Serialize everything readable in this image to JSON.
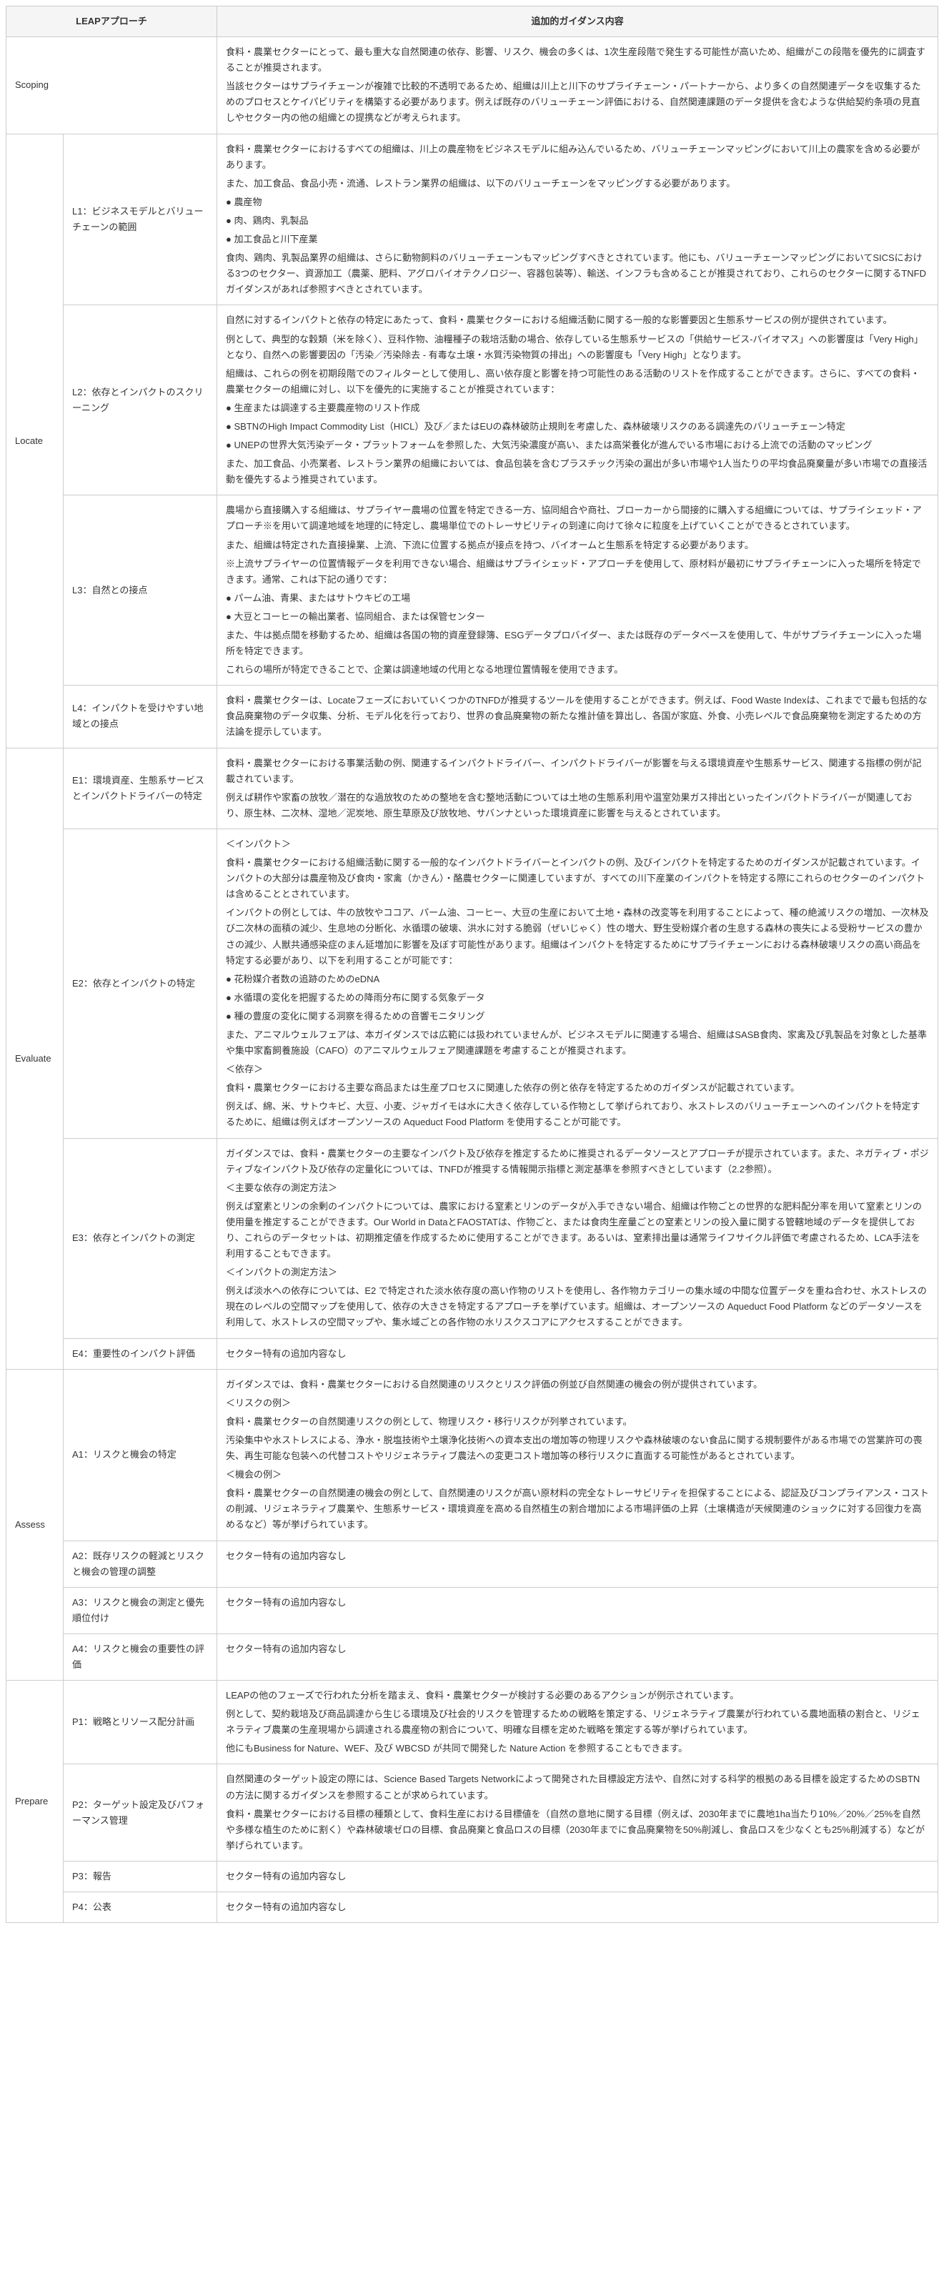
{
  "headers": {
    "approach": "LEAPアプローチ",
    "content": "追加的ガイダンス内容"
  },
  "phases": {
    "scoping": "Scoping",
    "locate": "Locate",
    "evaluate": "Evaluate",
    "assess": "Assess",
    "prepare": "Prepare"
  },
  "sub": {
    "l1": "L1：ビジネスモデルとバリューチェーンの範囲",
    "l2": "L2：依存とインパクトのスクリーニング",
    "l3": "L3：自然との接点",
    "l4": "L4：インパクトを受けやすい地域との接点",
    "e1": "E1：環境資産、生態系サービスとインパクトドライバーの特定",
    "e2": "E2：依存とインパクトの特定",
    "e3": "E3：依存とインパクトの測定",
    "e4": "E4：重要性のインパクト評価",
    "a1": "A1：リスクと機会の特定",
    "a2": "A2：既存リスクの軽減とリスクと機会の管理の調整",
    "a3": "A3：リスクと機会の測定と優先順位付け",
    "a4": "A4：リスクと機会の重要性の評価",
    "p1": "P1：戦略とリソース配分計画",
    "p2": "P2：ターゲット設定及びパフォーマンス管理",
    "p3": "P3：報告",
    "p4": "P4：公表"
  },
  "content": {
    "scoping": [
      "食料・農業セクターにとって、最も重大な自然関連の依存、影響、リスク、機会の多くは、1次生産段階で発生する可能性が高いため、組織がこの段階を優先的に調査することが推奨されます。",
      "当該セクターはサプライチェーンが複雑で比較的不透明であるため、組織は川上と川下のサプライチェーン・パートナーから、より多くの自然関連データを収集するためのプロセスとケイパビリティを構築する必要があります。例えば既存のバリューチェーン評価における、自然関連課題のデータ提供を含むような供給契約条項の見直しやセクター内の他の組織との提携などが考えられます。"
    ],
    "l1": [
      "食料・農業セクターにおけるすべての組織は、川上の農産物をビジネスモデルに組み込んでいるため、バリューチェーンマッピングにおいて川上の農家を含める必要があります。",
      "また、加工食品、食品小売・流通、レストラン業界の組織は、以下のバリューチェーンをマッピングする必要があります。",
      "● 農産物",
      "● 肉、鶏肉、乳製品",
      "● 加工食品と川下産業",
      "食肉、鶏肉、乳製品業界の組織は、さらに動物飼料のバリューチェーンもマッピングすべきとされています。他にも、バリューチェーンマッピングにおいてSICSにおける3つのセクター、資源加工（農薬、肥料、アグロバイオテクノロジー、容器包装等）、輸送、インフラも含めることが推奨されており、これらのセクターに関するTNFDガイダンスがあれば参照すべきとされています。"
    ],
    "l2": [
      "自然に対するインパクトと依存の特定にあたって、食料・農業セクターにおける組織活動に関する一般的な影響要因と生態系サービスの例が提供されています。",
      "例として、典型的な穀類（米を除く）、豆科作物、油糧種子の栽培活動の場合、依存している生態系サービスの「供給サービス-バイオマス」への影響度は「Very High」となり、自然への影響要因の「汚染／汚染除去 - 有毒な土壌・水質汚染物質の排出」への影響度も「Very High」となります。",
      "組織は、これらの例を初期段階でのフィルターとして使用し、高い依存度と影響を持つ可能性のある活動のリストを作成することができます。さらに、すべての食料・農業セクターの組織に対し、以下を優先的に実施することが推奨されています：",
      "● 生産または調達する主要農産物のリスト作成",
      "● SBTNのHigh Impact Commodity List（HICL）及び／またはEUの森林破防止規則を考慮した、森林破壊リスクのある調達先のバリューチェーン特定",
      "● UNEPの世界大気汚染データ・プラットフォームを参照した、大気汚染濃度が高い、または高栄養化が進んでいる市場における上流での活動のマッピング",
      "また、加工食品、小売業者、レストラン業界の組織においては、食品包装を含むプラスチック汚染の漏出が多い市場や1人当たりの平均食品廃棄量が多い市場での直接活動を優先するよう推奨されています。"
    ],
    "l3": [
      "農場から直接購入する組織は、サプライヤー農場の位置を特定できる一方、協同組合や商社、ブローカーから間接的に購入する組織については、サプライシェッド・アプローチ※を用いて調達地域を地理的に特定し、農場単位でのトレーサビリティの到達に向けて徐々に粒度を上げていくことができるとされています。",
      "また、組織は特定された直接操業、上流、下流に位置する拠点が接点を持つ、バイオームと生態系を特定する必要があります。",
      "※上流サプライヤーの位置情報データを利用できない場合、組織はサプライシェッド・アプローチを使用して、原材料が最初にサプライチェーンに入った場所を特定できます。通常、これは下記の通りです：",
      "● パーム油、青果、またはサトウキビの工場",
      "● 大豆とコーヒーの輸出業者、協同組合、または保管センター",
      "また、牛は拠点間を移動するため、組織は各国の物的資産登録簿、ESGデータプロバイダー、または既存のデータベースを使用して、牛がサプライチェーンに入った場所を特定できます。",
      "これらの場所が特定できることで、企業は調達地域の代用となる地理位置情報を使用できます。"
    ],
    "l4": [
      "食料・農業セクターは、LocateフェーズにおいていくつかのTNFDが推奨するツールを使用することができます。例えば、Food Waste Indexは、これまでで最も包括的な食品廃棄物のデータ収集、分析、モデル化を行っており、世界の食品廃棄物の新たな推計値を算出し、各国が家庭、外食、小売レベルで食品廃棄物を測定するための方法論を提示しています。"
    ],
    "e1": [
      "食料・農業セクターにおける事業活動の例、関連するインパクトドライバー、インパクトドライバーが影響を与える環境資産や生態系サービス、関連する指標の例が記載されています。",
      "例えば耕作や家畜の放牧／潜在的な過放牧のための整地を含む整地活動については土地の生態系利用や温室効果ガス排出といったインパクトドライバーが関連しており、原生林、二次林、湿地／泥炭地、原生草原及び放牧地、サバンナといった環境資産に影響を与えるとされています。"
    ],
    "e2": [
      "＜インパクト＞",
      "食料・農業セクターにおける組織活動に関する一般的なインパクトドライバーとインパクトの例、及びインパクトを特定するためのガイダンスが記載されています。インパクトの大部分は農産物及び食肉・家禽（かきん）・酪農セクターに関連していますが、すべての川下産業のインパクトを特定する際にこれらのセクターのインパクトは含めることとされています。",
      "インパクトの例としては、牛の放牧やココア、パーム油、コーヒー、大豆の生産において土地・森林の改変等を利用することによって、種の絶滅リスクの増加、一次林及び二次林の面積の減少、生息地の分断化、水循環の破壊、洪水に対する脆弱（ぜいじゃく）性の増大、野生受粉媒介者の生息する森林の喪失による受粉サービスの豊かさの減少、人獣共通感染症のまん延増加に影響を及ぼす可能性があります。組織はインパクトを特定するためにサプライチェーンにおける森林破壊リスクの高い商品を特定する必要があり、以下を利用することが可能です：",
      "● 花粉媒介者数の追跡のためのeDNA",
      "● 水循環の変化を把握するための降雨分布に関する気象データ",
      "● 種の豊度の変化に関する洞察を得るための音響モニタリング",
      "また、アニマルウェルフェアは、本ガイダンスでは広範には扱われていませんが、ビジネスモデルに関連する場合、組織はSASB食肉、家禽及び乳製品を対象とした基準や集中家畜飼養施設（CAFO）のアニマルウェルフェア関連課題を考慮することが推奨されます。",
      "＜依存＞",
      "食料・農業セクターにおける主要な商品または生産プロセスに関連した依存の例と依存を特定するためのガイダンスが記載されています。",
      "例えば、綿、米、サトウキビ、大豆、小麦、ジャガイモは水に大きく依存している作物として挙げられており、水ストレスのバリューチェーンへのインパクトを特定するために、組織は例えばオープンソースの Aqueduct Food Platform を使用することが可能です。"
    ],
    "e3": [
      "ガイダンスでは、食料・農業セクターの主要なインパクト及び依存を推定するために推奨されるデータソースとアプローチが提示されています。また、ネガティブ・ポジティブなインパクト及び依存の定量化については、TNFDが推奨する情報開示指標と測定基準を参照すべきとしています（2.2参照）。",
      "＜主要な依存の測定方法＞",
      "例えば窒素とリンの余剰のインパクトについては、農家における窒素とリンのデータが入手できない場合、組織は作物ごとの世界的な肥料配分率を用いて窒素とリンの使用量を推定することができます。Our World in DataとFAOSTATは、作物ごと、または食肉生産量ごとの窒素とリンの投入量に関する管轄地域のデータを提供しており、これらのデータセットは、初期推定値を作成するために使用することができます。あるいは、窒素排出量は通常ライフサイクル評価で考慮されるため、LCA手法を利用することもできます。",
      "＜インパクトの測定方法＞",
      "例えば淡水への依存については、E2 で特定された淡水依存度の高い作物のリストを使用し、各作物カテゴリーの集水域の中間な位置データを重ね合わせ、水ストレスの現在のレベルの空間マップを使用して、依存の大きさを特定するアプローチを挙げています。組織は、オープンソースの Aqueduct Food Platform などのデータソースを利用して、水ストレスの空間マップや、集水域ごとの各作物の水リスクスコアにアクセスすることができます。"
    ],
    "e4": [
      "セクター特有の追加内容なし"
    ],
    "a1": [
      "ガイダンスでは、食料・農業セクターにおける自然関連のリスクとリスク評価の例並び自然関連の機会の例が提供されています。",
      "＜リスクの例＞",
      "食料・農業セクターの自然関連リスクの例として、物理リスク・移行リスクが列挙されています。",
      "汚染集中や水ストレスによる、浄水・脱塩技術や土壌浄化技術への資本支出の増加等の物理リスクや森林破壊のない食品に関する規制要件がある市場での営業許可の喪失、再生可能な包装への代替コストやリジェネラティブ農法への変更コスト増加等の移行リスクに直面する可能性があるとされています。",
      "＜機会の例＞",
      "食料・農業セクターの自然関連の機会の例として、自然関連のリスクが高い原材料の完全なトレーサビリティを担保することによる、認証及びコンプライアンス・コストの削減、リジェネラティブ農業や、生態系サービス・環境資産を高める自然植生の割合増加による市場評価の上昇（土壌構造が天候関連のショックに対する回復力を高めるなど）等が挙げられています。"
    ],
    "a2": [
      "セクター特有の追加内容なし"
    ],
    "a3": [
      "セクター特有の追加内容なし"
    ],
    "a4": [
      "セクター特有の追加内容なし"
    ],
    "p1": [
      "LEAPの他のフェーズで行われた分析を踏まえ、食料・農業セクターが検討する必要のあるアクションが例示されています。",
      "例として、契約栽培及び商品調達から生じる環境及び社会的リスクを管理するための戦略を策定する、リジェネラティブ農業が行われている農地面積の割合と、リジェネラティブ農業の生産現場から調達される農産物の割合について、明確な目標を定めた戦略を策定する等が挙げられています。",
      "他にもBusiness for Nature、WEF、及び WBCSD が共同で開発した Nature Action を参照することもできます。"
    ],
    "p2": [
      "自然関連のターゲット設定の際には、Science Based Targets Networkによって開発された目標設定方法や、自然に対する科学的根拠のある目標を設定するためのSBTNの方法に関するガイダンスを参照することが求められています。",
      "食料・農業セクターにおける目標の種類として、食料生産における目標値を（自然の意地に関する目標（例えば、2030年までに農地1ha当たり10%／20%／25%を自然や多様な植生のために割く）や森林破壊ゼロの目標、食品廃棄と食品ロスの目標（2030年までに食品廃棄物を50%削減し、食品ロスを少なくとも25%削減する）などが挙げられています。"
    ],
    "p3": [
      "セクター特有の追加内容なし"
    ],
    "p4": [
      "セクター特有の追加内容なし"
    ]
  }
}
